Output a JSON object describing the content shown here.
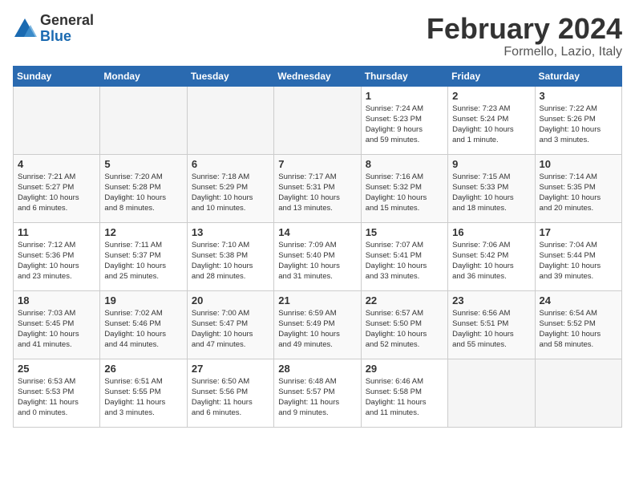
{
  "logo": {
    "general": "General",
    "blue": "Blue"
  },
  "header": {
    "month": "February 2024",
    "location": "Formello, Lazio, Italy"
  },
  "days_of_week": [
    "Sunday",
    "Monday",
    "Tuesday",
    "Wednesday",
    "Thursday",
    "Friday",
    "Saturday"
  ],
  "weeks": [
    [
      {
        "day": "",
        "info": ""
      },
      {
        "day": "",
        "info": ""
      },
      {
        "day": "",
        "info": ""
      },
      {
        "day": "",
        "info": ""
      },
      {
        "day": "1",
        "info": "Sunrise: 7:24 AM\nSunset: 5:23 PM\nDaylight: 9 hours\nand 59 minutes."
      },
      {
        "day": "2",
        "info": "Sunrise: 7:23 AM\nSunset: 5:24 PM\nDaylight: 10 hours\nand 1 minute."
      },
      {
        "day": "3",
        "info": "Sunrise: 7:22 AM\nSunset: 5:26 PM\nDaylight: 10 hours\nand 3 minutes."
      }
    ],
    [
      {
        "day": "4",
        "info": "Sunrise: 7:21 AM\nSunset: 5:27 PM\nDaylight: 10 hours\nand 6 minutes."
      },
      {
        "day": "5",
        "info": "Sunrise: 7:20 AM\nSunset: 5:28 PM\nDaylight: 10 hours\nand 8 minutes."
      },
      {
        "day": "6",
        "info": "Sunrise: 7:18 AM\nSunset: 5:29 PM\nDaylight: 10 hours\nand 10 minutes."
      },
      {
        "day": "7",
        "info": "Sunrise: 7:17 AM\nSunset: 5:31 PM\nDaylight: 10 hours\nand 13 minutes."
      },
      {
        "day": "8",
        "info": "Sunrise: 7:16 AM\nSunset: 5:32 PM\nDaylight: 10 hours\nand 15 minutes."
      },
      {
        "day": "9",
        "info": "Sunrise: 7:15 AM\nSunset: 5:33 PM\nDaylight: 10 hours\nand 18 minutes."
      },
      {
        "day": "10",
        "info": "Sunrise: 7:14 AM\nSunset: 5:35 PM\nDaylight: 10 hours\nand 20 minutes."
      }
    ],
    [
      {
        "day": "11",
        "info": "Sunrise: 7:12 AM\nSunset: 5:36 PM\nDaylight: 10 hours\nand 23 minutes."
      },
      {
        "day": "12",
        "info": "Sunrise: 7:11 AM\nSunset: 5:37 PM\nDaylight: 10 hours\nand 25 minutes."
      },
      {
        "day": "13",
        "info": "Sunrise: 7:10 AM\nSunset: 5:38 PM\nDaylight: 10 hours\nand 28 minutes."
      },
      {
        "day": "14",
        "info": "Sunrise: 7:09 AM\nSunset: 5:40 PM\nDaylight: 10 hours\nand 31 minutes."
      },
      {
        "day": "15",
        "info": "Sunrise: 7:07 AM\nSunset: 5:41 PM\nDaylight: 10 hours\nand 33 minutes."
      },
      {
        "day": "16",
        "info": "Sunrise: 7:06 AM\nSunset: 5:42 PM\nDaylight: 10 hours\nand 36 minutes."
      },
      {
        "day": "17",
        "info": "Sunrise: 7:04 AM\nSunset: 5:44 PM\nDaylight: 10 hours\nand 39 minutes."
      }
    ],
    [
      {
        "day": "18",
        "info": "Sunrise: 7:03 AM\nSunset: 5:45 PM\nDaylight: 10 hours\nand 41 minutes."
      },
      {
        "day": "19",
        "info": "Sunrise: 7:02 AM\nSunset: 5:46 PM\nDaylight: 10 hours\nand 44 minutes."
      },
      {
        "day": "20",
        "info": "Sunrise: 7:00 AM\nSunset: 5:47 PM\nDaylight: 10 hours\nand 47 minutes."
      },
      {
        "day": "21",
        "info": "Sunrise: 6:59 AM\nSunset: 5:49 PM\nDaylight: 10 hours\nand 49 minutes."
      },
      {
        "day": "22",
        "info": "Sunrise: 6:57 AM\nSunset: 5:50 PM\nDaylight: 10 hours\nand 52 minutes."
      },
      {
        "day": "23",
        "info": "Sunrise: 6:56 AM\nSunset: 5:51 PM\nDaylight: 10 hours\nand 55 minutes."
      },
      {
        "day": "24",
        "info": "Sunrise: 6:54 AM\nSunset: 5:52 PM\nDaylight: 10 hours\nand 58 minutes."
      }
    ],
    [
      {
        "day": "25",
        "info": "Sunrise: 6:53 AM\nSunset: 5:53 PM\nDaylight: 11 hours\nand 0 minutes."
      },
      {
        "day": "26",
        "info": "Sunrise: 6:51 AM\nSunset: 5:55 PM\nDaylight: 11 hours\nand 3 minutes."
      },
      {
        "day": "27",
        "info": "Sunrise: 6:50 AM\nSunset: 5:56 PM\nDaylight: 11 hours\nand 6 minutes."
      },
      {
        "day": "28",
        "info": "Sunrise: 6:48 AM\nSunset: 5:57 PM\nDaylight: 11 hours\nand 9 minutes."
      },
      {
        "day": "29",
        "info": "Sunrise: 6:46 AM\nSunset: 5:58 PM\nDaylight: 11 hours\nand 11 minutes."
      },
      {
        "day": "",
        "info": ""
      },
      {
        "day": "",
        "info": ""
      }
    ]
  ]
}
